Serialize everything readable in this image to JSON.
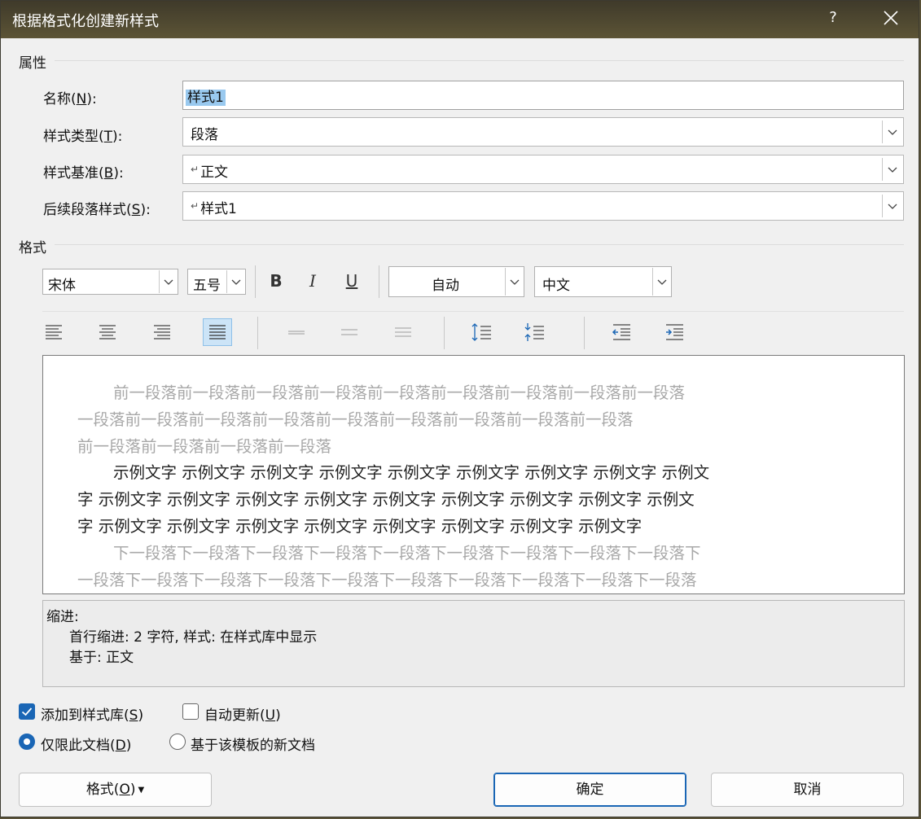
{
  "title": "根据格式化创建新样式",
  "title_help": "?",
  "properties": {
    "section": "属性",
    "name_label": "名称(N):",
    "name_value": "样式1",
    "type_label": "样式类型(T):",
    "type_value": "段落",
    "base_label": "样式基准(B):",
    "base_value": "正文",
    "next_label": "后续段落样式(S):",
    "next_value": "样式1"
  },
  "format": {
    "section": "格式",
    "font": "宋体",
    "size": "五号",
    "bold": "B",
    "italic": "I",
    "underline": "U",
    "color": "自动",
    "script": "中文"
  },
  "preview": {
    "prev_lines": [
      "前一段落前一段落前一段落前一段落前一段落前一段落前一段落前一段落前一段落",
      "一段落前一段落前一段落前一段落前一段落前一段落前一段落前一段落前一段落",
      "前一段落前一段落前一段落前一段落"
    ],
    "sample_lines": [
      "示例文字  示例文字  示例文字  示例文字  示例文字  示例文字  示例文字  示例文字  示例文",
      "字  示例文字  示例文字  示例文字  示例文字  示例文字  示例文字  示例文字  示例文字  示例文",
      "字  示例文字  示例文字  示例文字  示例文字  示例文字  示例文字  示例文字  示例文字"
    ],
    "next_lines": [
      "下一段落下一段落下一段落下一段落下一段落下一段落下一段落下一段落下一段落下",
      "一段落下一段落下一段落下一段落下一段落下一段落下一段落下一段落下一段落下一段落"
    ]
  },
  "description": {
    "line1": "缩进:",
    "line2": "首行缩进:  2 字符, 样式: 在样式库中显示",
    "line3": "基于: 正文"
  },
  "options": {
    "add_to_gallery": "添加到样式库(S)",
    "add_to_gallery_checked": true,
    "auto_update": "自动更新(U)",
    "auto_update_checked": false,
    "only_this_doc": "仅限此文档(D)",
    "only_this_doc_selected": true,
    "new_docs_template": "基于该模板的新文档",
    "new_docs_template_selected": false
  },
  "buttons": {
    "format": "格式(O)",
    "ok": "确定",
    "cancel": "取消"
  },
  "colors": {
    "accent": "#1a66b5",
    "selection": "#99c9ef"
  }
}
